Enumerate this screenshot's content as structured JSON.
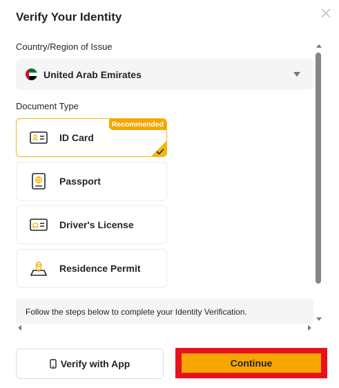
{
  "dialog": {
    "title": "Verify Your Identity"
  },
  "country": {
    "label": "Country/Region of Issue",
    "value": "United Arab Emirates",
    "flag_colors": {
      "red": "#ce1126",
      "green": "#00732f",
      "white": "#ffffff",
      "black": "#000000"
    }
  },
  "document_type": {
    "label": "Document Type",
    "options": [
      {
        "label": "ID Card",
        "icon": "id-card-icon",
        "selected": true,
        "badge": "Recommended"
      },
      {
        "label": "Passport",
        "icon": "passport-icon",
        "selected": false
      },
      {
        "label": "Driver's License",
        "icon": "drivers-license-icon",
        "selected": false
      },
      {
        "label": "Residence Permit",
        "icon": "residence-permit-icon",
        "selected": false
      }
    ]
  },
  "steps_text": "Follow the steps below to complete your Identity Verification.",
  "actions": {
    "verify_app_label": "Verify with App",
    "continue_label": "Continue"
  },
  "colors": {
    "accent": "#f7a600",
    "selected_border": "#f0b90b",
    "highlight_frame": "#e8121d"
  }
}
